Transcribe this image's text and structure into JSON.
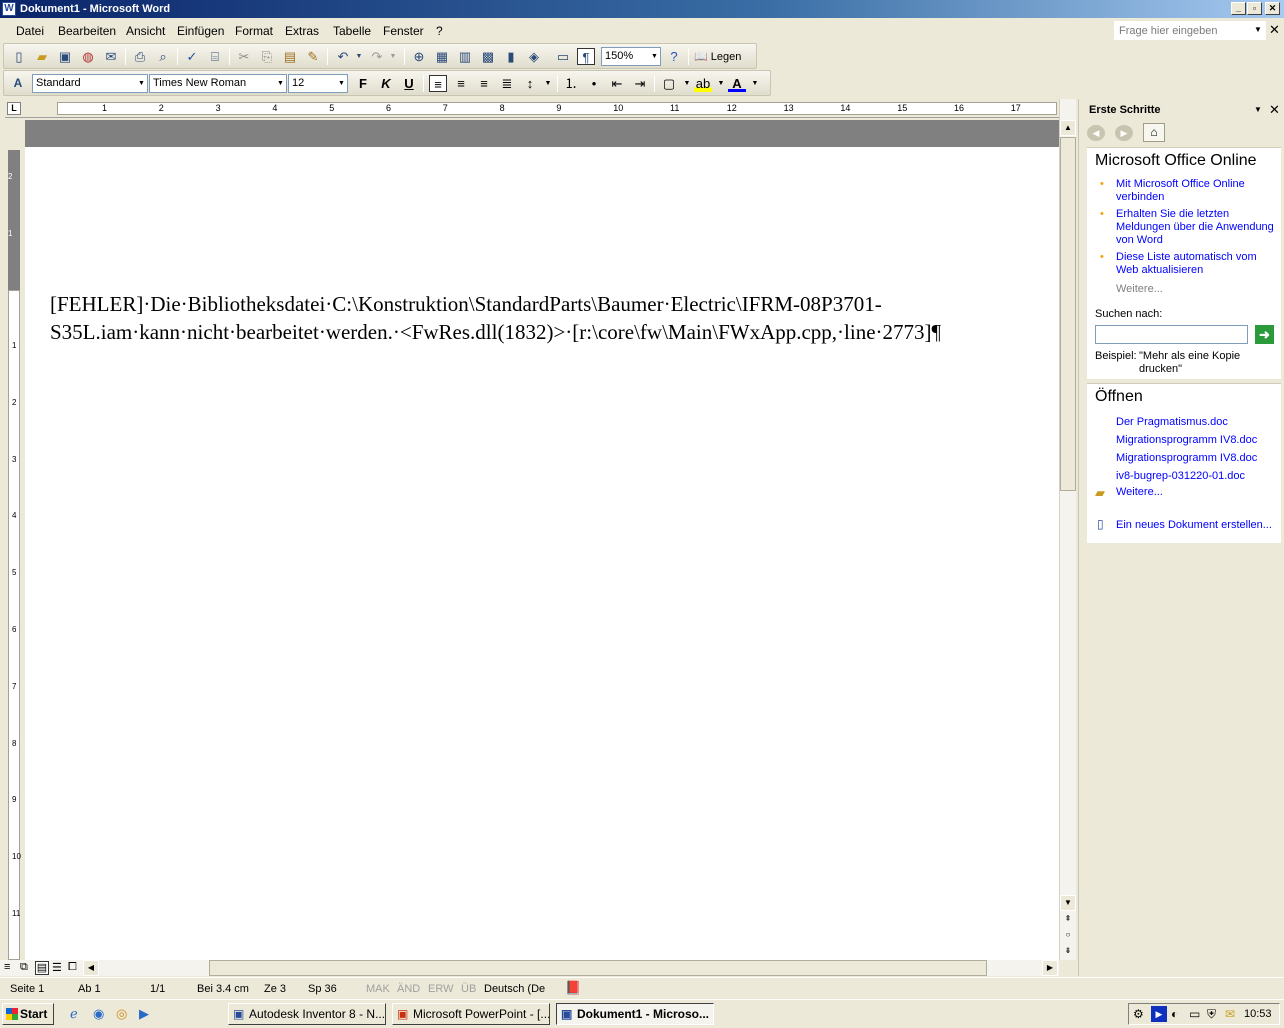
{
  "window": {
    "title": "Dokument1 - Microsoft Word",
    "icon": "word-icon"
  },
  "menu": {
    "items": [
      "Datei",
      "Bearbeiten",
      "Ansicht",
      "Einfügen",
      "Format",
      "Extras",
      "Tabelle",
      "Fenster",
      "?"
    ],
    "ask_placeholder": "Frage hier eingeben"
  },
  "toolbar": {
    "zoom": "150%",
    "read_label": "Legen",
    "style": "Standard",
    "font": "Times New Roman",
    "size": "12",
    "bold": "F",
    "italic": "K",
    "underline": "U"
  },
  "ruler": {
    "h_numbers": [
      "1",
      "2",
      "3",
      "4",
      "5",
      "6",
      "7",
      "8",
      "9",
      "10",
      "11",
      "12",
      "13",
      "14",
      "15",
      "16",
      "17"
    ],
    "v_numbers": [
      "2",
      "1",
      "1",
      "2",
      "3",
      "4",
      "5",
      "6",
      "7",
      "8",
      "9",
      "10",
      "11"
    ]
  },
  "document": {
    "text": "[FEHLER]·Die·Bibliotheksdatei·C:\\Konstruktion\\StandardParts\\Baumer·Electric\\IFRM-08P3701-S35L.iam·kann·nicht·bearbeitet·werden.·<FwRes.dll(1832)>·[r:\\core\\fw\\Main\\FWxApp.cpp,·line·2773]¶"
  },
  "taskpane": {
    "title": "Erste Schritte",
    "online_heading": "Microsoft Office Online",
    "online_links": [
      "Mit Microsoft Office Online verbinden",
      "Erhalten Sie die letzten Meldungen über die Anwendung von Word",
      "Diese Liste automatisch vom Web aktualisieren"
    ],
    "more_label": "Weitere...",
    "search_label": "Suchen nach:",
    "example_label": "Beispiel:",
    "example_text": "\"Mehr als eine Kopie drucken\"",
    "open_heading": "Öffnen",
    "recent_files": [
      "Der Pragmatismus.doc",
      "Migrationsprogramm IV8.doc",
      "Migrationsprogramm IV8.doc",
      "iv8-bugrep-031220-01.doc"
    ],
    "open_more": "Weitere...",
    "new_doc": "Ein neues Dokument erstellen..."
  },
  "status": {
    "page": "Seite  1",
    "section": "Ab  1",
    "pages": "1/1",
    "position": "Bei  3.4 cm",
    "line": "Ze  3",
    "column": "Sp  36",
    "mak": "MAK",
    "and": "ÄND",
    "erw": "ERW",
    "ub": "ÜB",
    "language": "Deutsch (De"
  },
  "taskbar": {
    "start": "Start",
    "tasks": [
      "Autodesk Inventor 8  - N...",
      "Microsoft PowerPoint - [...",
      "Dokument1 - Microso..."
    ],
    "clock": "10:53"
  }
}
